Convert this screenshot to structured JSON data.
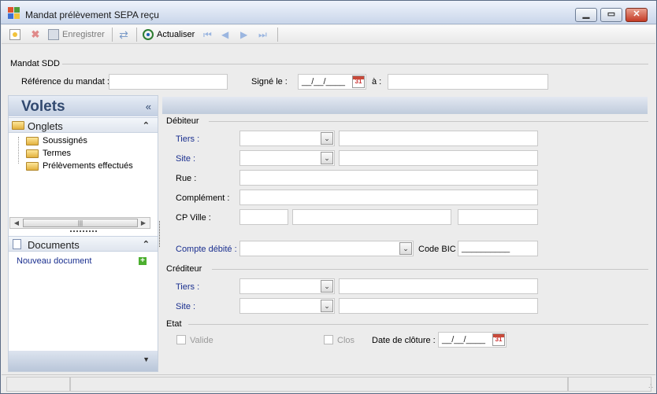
{
  "window": {
    "title": "Mandat prélèvement SEPA reçu"
  },
  "toolbar": {
    "save_label": "Enregistrer",
    "refresh_label": "Actualiser"
  },
  "mandat": {
    "group_title": "Mandat SDD",
    "reference_label": "Référence du mandat :",
    "reference_value": "",
    "signed_label": "Signé le :",
    "signed_value": "__/__/____",
    "at_label": "à :",
    "at_value": ""
  },
  "sidebar": {
    "title": "Volets",
    "collapse_glyph": "«",
    "onglets": {
      "title": "Onglets",
      "items": [
        "Soussignés",
        "Termes",
        "Prélèvements effectués"
      ]
    },
    "documents": {
      "title": "Documents",
      "new_link": "Nouveau document"
    }
  },
  "debiteur": {
    "group_title": "Débiteur",
    "tiers_label": "Tiers :",
    "site_label": "Site :",
    "rue_label": "Rue :",
    "complement_label": "Complément :",
    "cpville_label": "CP Ville :",
    "compte_label": "Compte débité :",
    "bic_label": "Code BIC :",
    "bic_value": "__________"
  },
  "crediteur": {
    "group_title": "Créditeur",
    "tiers_label": "Tiers :",
    "site_label": "Site :"
  },
  "etat": {
    "group_title": "Etat",
    "valide_label": "Valide",
    "clos_label": "Clos",
    "cloture_label": "Date de clôture :",
    "cloture_value": "__/__/____"
  },
  "colors": {
    "accent": "#1a2f8f",
    "panel_header": "#c3cfe2",
    "title_text": "#324a70"
  },
  "icons": {
    "calendar": "31"
  }
}
